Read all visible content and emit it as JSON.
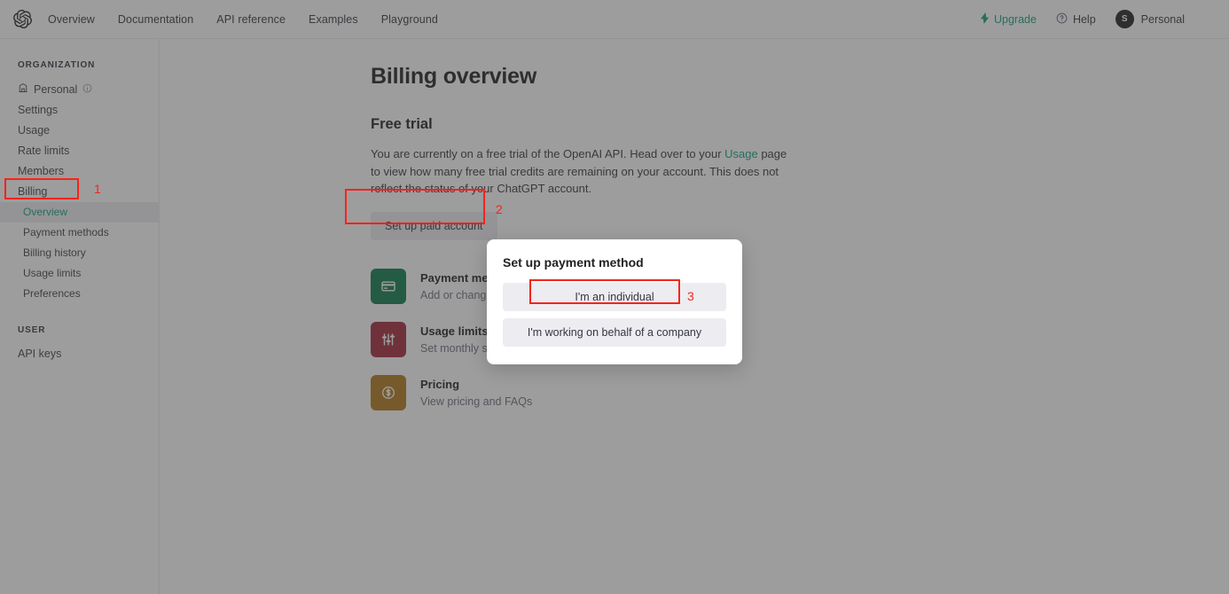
{
  "topnav": {
    "logo_icon": "openai-logo-icon",
    "links": [
      "Overview",
      "Documentation",
      "API reference",
      "Examples",
      "Playground"
    ],
    "upgrade_label": "Upgrade",
    "upgrade_icon": "spark-icon",
    "upgrade_color": "#10a37f",
    "help_label": "Help",
    "help_icon": "question-circle-icon",
    "account_label": "Personal",
    "account_initial": "S"
  },
  "sidebar": {
    "org_section": "ORGANIZATION",
    "org_items": [
      {
        "label": "Personal",
        "icon": "building-icon",
        "trailing_icon": "info-circle-icon"
      },
      {
        "label": "Settings"
      },
      {
        "label": "Usage"
      },
      {
        "label": "Rate limits"
      },
      {
        "label": "Members"
      },
      {
        "label": "Billing"
      }
    ],
    "billing_subitems": [
      {
        "label": "Overview",
        "active": true
      },
      {
        "label": "Payment methods",
        "active": false
      },
      {
        "label": "Billing history",
        "active": false
      },
      {
        "label": "Usage limits",
        "active": false
      },
      {
        "label": "Preferences",
        "active": false
      }
    ],
    "user_section": "USER",
    "user_items": [
      {
        "label": "API keys"
      }
    ],
    "active_color": "#10a37f",
    "active_bg": "#ececf1"
  },
  "main": {
    "page_title": "Billing overview",
    "section_title": "Free trial",
    "paragraph_part1": "You are currently on a free trial of the OpenAI API. Head over to your ",
    "paragraph_link": "Usage",
    "paragraph_part2": " page to view how many free trial credits are remaining on your account. This does not reflect the status of your ChatGPT account.",
    "setup_button": "Set up paid account",
    "cards": [
      {
        "title": "Payment methods",
        "desc": "Add or change payment method, view current invoices",
        "icon": "credit-card-icon",
        "color": "#0d7a4f"
      },
      {
        "title": "Usage limits",
        "desc": "Set monthly spend limits and view billing information",
        "icon": "sliders-icon",
        "color": "#a3293a"
      },
      {
        "title": "Pricing",
        "desc": "View pricing and FAQs",
        "icon": "dollar-circle-icon",
        "color": "#b1791b"
      }
    ]
  },
  "modal": {
    "title": "Set up payment method",
    "buttons": [
      {
        "label": "I'm an individual"
      },
      {
        "label": "I'm working on behalf of a company"
      }
    ]
  },
  "annotations": {
    "color": "#f8231b",
    "markers": [
      {
        "number": "1",
        "target": "sidebar-item-billing"
      },
      {
        "number": "2",
        "target": "setup-paid-account-button"
      },
      {
        "number": "3",
        "target": "modal-individual-button"
      }
    ]
  }
}
